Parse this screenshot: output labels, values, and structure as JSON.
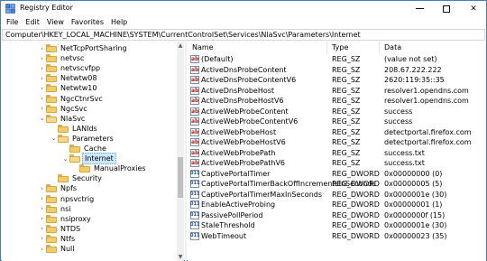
{
  "window": {
    "title": "Registry Editor"
  },
  "menu": [
    "File",
    "Edit",
    "View",
    "Favorites",
    "Help"
  ],
  "address": "Computer\\HKEY_LOCAL_MACHINE\\SYSTEM\\CurrentControlSet\\Services\\NlaSvc\\Parameters\\Internet",
  "tree": {
    "items": [
      {
        "label": "NetTcpPortSharing",
        "expanded": false
      },
      {
        "label": "netvsc",
        "expanded": false
      },
      {
        "label": "netvscvfpp",
        "expanded": false
      },
      {
        "label": "Netwtw08",
        "expanded": false
      },
      {
        "label": "Netwtw10",
        "expanded": false
      },
      {
        "label": "NgcCtnrSvc",
        "expanded": false
      },
      {
        "label": "NgcSvc",
        "expanded": false
      },
      {
        "label": "NlaSvc",
        "expanded": true
      },
      {
        "label": "LANIds",
        "expanded": false
      },
      {
        "label": "Parameters",
        "expanded": true
      },
      {
        "label": "Cache",
        "expanded": false
      },
      {
        "label": "Internet",
        "expanded": true,
        "selected": true
      },
      {
        "label": "ManualProxies",
        "expanded": false
      },
      {
        "label": "Security",
        "expanded": false
      },
      {
        "label": "Npfs",
        "expanded": false
      },
      {
        "label": "npsvctrig",
        "expanded": false
      },
      {
        "label": "nsi",
        "expanded": false
      },
      {
        "label": "nsiproxy",
        "expanded": false
      },
      {
        "label": "NTDS",
        "expanded": false
      },
      {
        "label": "Ntfs",
        "expanded": false
      },
      {
        "label": "Null",
        "expanded": false
      }
    ]
  },
  "values": {
    "headers": {
      "name": "Name",
      "type": "Type",
      "data": "Data"
    },
    "rows": [
      {
        "name": "(Default)",
        "type": "REG_SZ",
        "data": "(value not set)",
        "kind": "sz"
      },
      {
        "name": "ActiveDnsProbeContent",
        "type": "REG_SZ",
        "data": "208.67.222.222",
        "kind": "sz"
      },
      {
        "name": "ActiveDnsProbeContentV6",
        "type": "REG_SZ",
        "data": "2620:119:35::35",
        "kind": "sz"
      },
      {
        "name": "ActiveDnsProbeHost",
        "type": "REG_SZ",
        "data": "resolver1.opendns.com",
        "kind": "sz"
      },
      {
        "name": "ActiveDnsProbeHostV6",
        "type": "REG_SZ",
        "data": "resolver1.opendns.com",
        "kind": "sz"
      },
      {
        "name": "ActiveWebProbeContent",
        "type": "REG_SZ",
        "data": "success",
        "kind": "sz"
      },
      {
        "name": "ActiveWebProbeContentV6",
        "type": "REG_SZ",
        "data": "success",
        "kind": "sz"
      },
      {
        "name": "ActiveWebProbeHost",
        "type": "REG_SZ",
        "data": "detectportal.firefox.com",
        "kind": "sz"
      },
      {
        "name": "ActiveWebProbeHostV6",
        "type": "REG_SZ",
        "data": "detectportal.firefox.com",
        "kind": "sz"
      },
      {
        "name": "ActiveWebProbePath",
        "type": "REG_SZ",
        "data": "success.txt",
        "kind": "sz"
      },
      {
        "name": "ActiveWebProbePathV6",
        "type": "REG_SZ",
        "data": "success.txt",
        "kind": "sz"
      },
      {
        "name": "CaptivePortalTimer",
        "type": "REG_DWORD",
        "data": "0x00000000 (0)",
        "kind": "dw"
      },
      {
        "name": "CaptivePortalTimerBackOffIncrementsInSeconds",
        "type": "REG_DWORD",
        "data": "0x00000005 (5)",
        "kind": "dw"
      },
      {
        "name": "CaptivePortalTimerMaxInSeconds",
        "type": "REG_DWORD",
        "data": "0x0000001e (30)",
        "kind": "dw"
      },
      {
        "name": "EnableActiveProbing",
        "type": "REG_DWORD",
        "data": "0x00000001 (1)",
        "kind": "dw"
      },
      {
        "name": "PassivePollPeriod",
        "type": "REG_DWORD",
        "data": "0x0000000f (15)",
        "kind": "dw"
      },
      {
        "name": "StaleThreshold",
        "type": "REG_DWORD",
        "data": "0x0000001e (30)",
        "kind": "dw"
      },
      {
        "name": "WebTimeout",
        "type": "REG_DWORD",
        "data": "0x00000023 (35)",
        "kind": "dw"
      }
    ]
  },
  "icons": {
    "app": "registry-editor-icon",
    "folder": "folder-icon",
    "string_value": "reg-sz-icon",
    "dword_value": "reg-dword-icon"
  },
  "colors": {
    "selection": "#cce8ff",
    "folder": "#f3cc6a",
    "window_border": "#4a7db5"
  }
}
